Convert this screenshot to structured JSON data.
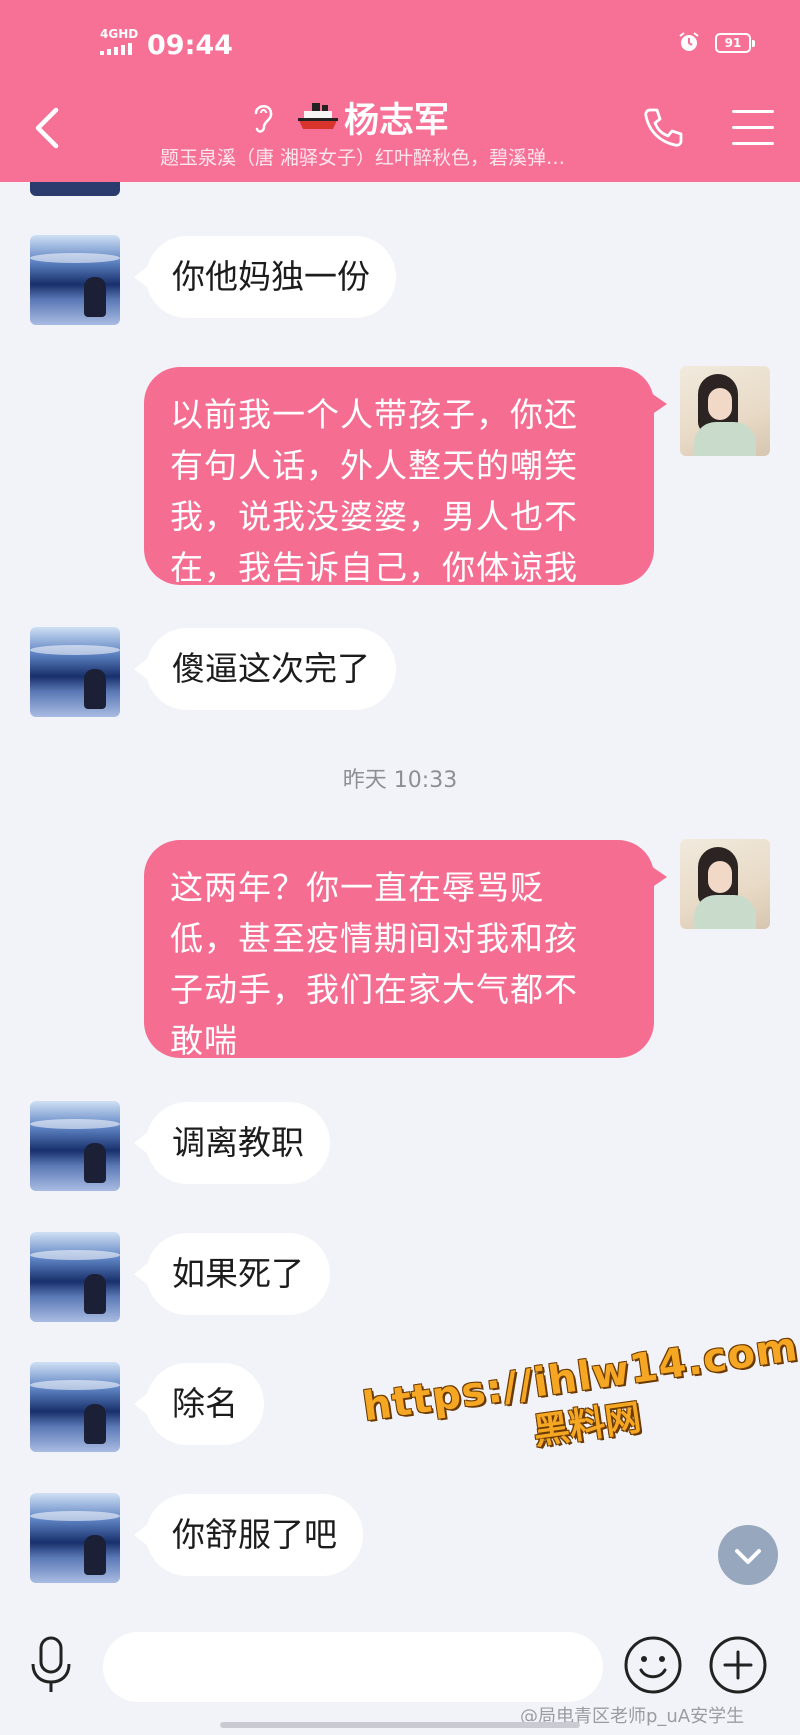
{
  "status_bar": {
    "network": "4GHD",
    "time": "09:44",
    "battery": "91"
  },
  "header": {
    "title": "杨志军",
    "subtitle": "题玉泉溪（唐 湘驿女子）红叶醉秋色，碧溪弹…",
    "background_color": "#f77197"
  },
  "messages": [
    {
      "side": "left",
      "text": "你他妈独一份"
    },
    {
      "side": "right",
      "lines": [
        "以前我一个人带孩子，你还",
        "有句人话，外人整天的嘲笑",
        "我，说我没婆婆，男人也不",
        "在，我告诉自己，你体谅我"
      ]
    },
    {
      "side": "left",
      "text": "傻逼这次完了"
    },
    {
      "side": "right",
      "lines": [
        "这两年？你一直在辱骂贬",
        "低，甚至疫情期间对我和孩",
        "子动手，我们在家大气都不",
        "敢喘"
      ]
    },
    {
      "side": "left",
      "text": "调离教职"
    },
    {
      "side": "left",
      "text": "如果死了"
    },
    {
      "side": "left",
      "text": "除名"
    },
    {
      "side": "left",
      "text": "你舒服了吧"
    }
  ],
  "timestamp": "昨天 10:33",
  "watermark": {
    "url": "https://ihlw14.com",
    "name": "黑料网"
  },
  "input": {
    "value": ""
  },
  "bottom_watermark": "@局电青区老师p_uA安学生",
  "colors": {
    "my_bubble": "#f66d92",
    "their_bubble": "#ffffff",
    "chat_background": "#f2f3f8"
  }
}
